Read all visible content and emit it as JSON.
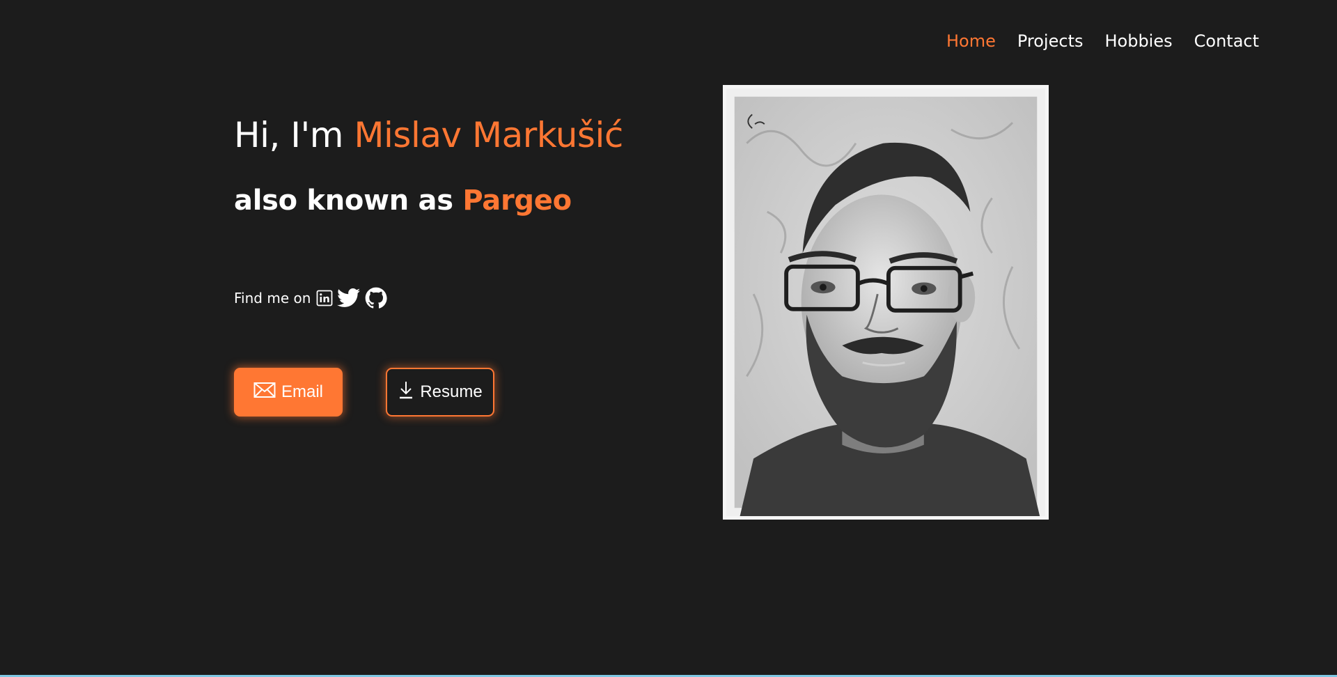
{
  "nav": {
    "items": [
      {
        "label": "Home",
        "active": true
      },
      {
        "label": "Projects",
        "active": false
      },
      {
        "label": "Hobbies",
        "active": false
      },
      {
        "label": "Contact",
        "active": false
      }
    ]
  },
  "hero": {
    "greeting_prefix": "Hi, I'm ",
    "name": "Mislav Markušić",
    "aka_prefix": "also known as ",
    "alias": "Pargeo",
    "find_label": "Find me on",
    "social": [
      {
        "icon": "linkedin-icon"
      },
      {
        "icon": "twitter-icon"
      },
      {
        "icon": "github-icon"
      }
    ]
  },
  "buttons": {
    "email_label": "Email",
    "email_icon": "envelope-icon",
    "resume_label": "Resume",
    "resume_icon": "download-icon"
  },
  "portrait": {
    "description_icon": "pencil-portrait-image"
  },
  "colors": {
    "accent": "#ff7733",
    "background": "#1c1c1c",
    "text": "#ffffff"
  }
}
